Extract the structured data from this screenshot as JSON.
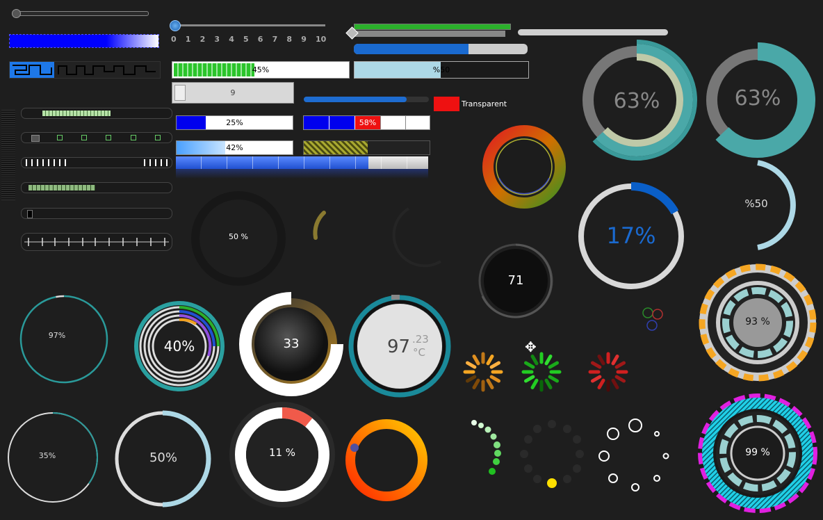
{
  "sliders": {
    "ticks": [
      "0",
      "1",
      "2",
      "3",
      "4",
      "5",
      "6",
      "7",
      "8",
      "9",
      "10"
    ],
    "progress_45": "45%",
    "progress_half": "%50",
    "scroll_value": "9",
    "transparent_label": "Transparent",
    "p25": "25%",
    "p58": "58%",
    "p42": "42%"
  },
  "gauges": {
    "big_63_a": "63%",
    "big_63_b": "63%",
    "ring_17": "17%",
    "arc_50": "%50",
    "dark_50": "50 %",
    "knob_71": "71",
    "ring_97": "97%",
    "multi_40": "40%",
    "dial_33": "33",
    "temp_main": "97",
    "temp_decimal": ".23",
    "temp_unit": "°C",
    "tech_93": "93 %",
    "ring_35": "35%",
    "ring_50": "50%",
    "ring_11": "11 %",
    "tech_99": "99 %"
  },
  "colors": {
    "teal": "#4aa8a8",
    "blue": "#0a5fc8",
    "orange": "#f5a623",
    "magenta": "#e020e0"
  },
  "values": {
    "big_63": 0.63,
    "ring_17": 0.17,
    "ring_97": 0.97,
    "ring_35": 0.35,
    "ring_50": 0.5,
    "ring_11": 0.11,
    "knob_71": 0.71
  }
}
